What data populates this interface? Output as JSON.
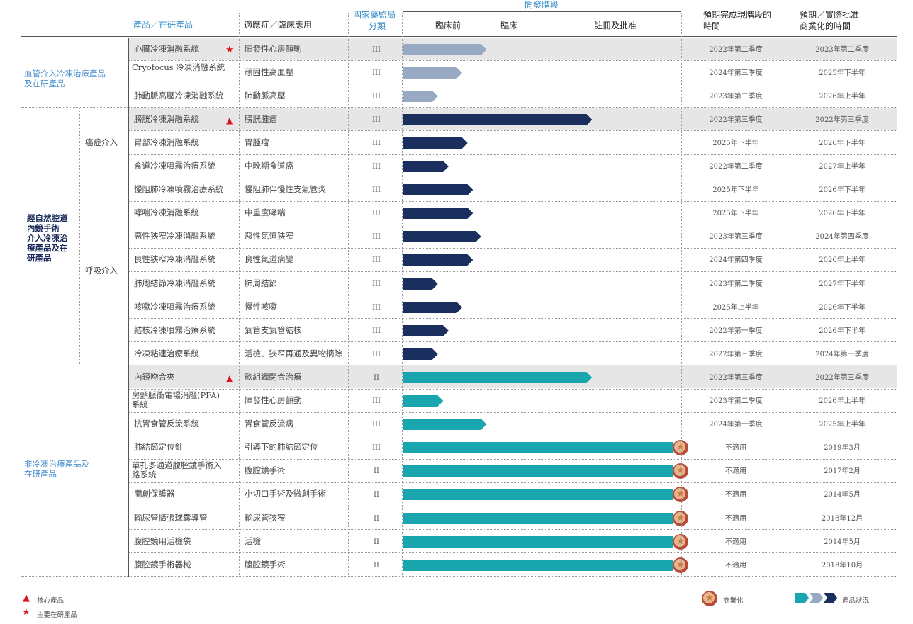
{
  "header": {
    "product": "產品／在研產品",
    "indication": "適應症／臨床應用",
    "nmpa": [
      "國家藥監局",
      "分類"
    ],
    "dev_stage": "開發階段",
    "stage_preclinical": "臨床前",
    "stage_clinical": "臨床",
    "stage_registration": "註冊及批准",
    "expected_completion": [
      "預期完成現階段的",
      "時間"
    ],
    "expected_commercial": [
      "預期／實際批准",
      "商業化的時間"
    ]
  },
  "groups": {
    "vascular": [
      "血管介入冷凍治療產品",
      "及在研產品"
    ],
    "natural": [
      "經自然腔道",
      "內鏡手術",
      "介入冷凍治",
      "療產品及在",
      "研產品"
    ],
    "cancer": "癌症介入",
    "respiratory": "呼吸介入",
    "noncryo": [
      "非冷凍治療產品及",
      "在研產品"
    ]
  },
  "rows": [
    {
      "product": "心臟冷凍消融系統",
      "indication": "陣發性心房顫動",
      "cls": "III",
      "progress": 0.31,
      "color": "gray",
      "done": "2022年第二季度",
      "commercial": "2023年第二季度",
      "highlight": true,
      "mark": "star"
    },
    {
      "product": "Cryofocus 冷凍消融系統",
      "indication": "頑固性高血壓",
      "cls": "III",
      "progress": 0.22,
      "color": "gray",
      "done": "2024年第三季度",
      "commercial": "2025年下半年",
      "highlight": false,
      "mark": ""
    },
    {
      "product": "肺動脈高壓冷凍消融系統",
      "indication": "肺動脈高壓",
      "cls": "III",
      "progress": 0.13,
      "color": "gray",
      "done": "2023年第二季度",
      "commercial": "2026年上半年",
      "highlight": false,
      "mark": ""
    },
    {
      "product": "膀胱冷凍消融系統",
      "indication": "膀胱腫瘤",
      "cls": "III",
      "progress": 0.7,
      "color": "navy",
      "done": "2022年第三季度",
      "commercial": "2022年第三季度",
      "highlight": true,
      "mark": "triangle"
    },
    {
      "product": "胃部冷凍消融系統",
      "indication": "胃腫瘤",
      "cls": "III",
      "progress": 0.24,
      "color": "navy",
      "done": "2025年下半年",
      "commercial": "2026年下半年",
      "highlight": false,
      "mark": ""
    },
    {
      "product": "食道冷凍噴霧治療系統",
      "indication": "中晚期食道癌",
      "cls": "III",
      "progress": 0.17,
      "color": "navy",
      "done": "2022年第二季度",
      "commercial": "2027年上半年",
      "highlight": false,
      "mark": ""
    },
    {
      "product": "慢阻肺冷凍噴霧治療系統",
      "indication": "慢阻肺伴慢性支氣管炎",
      "cls": "III",
      "progress": 0.26,
      "color": "navy",
      "done": "2025年下半年",
      "commercial": "2026年下半年",
      "highlight": false,
      "mark": ""
    },
    {
      "product": "哮喘冷凍消融系統",
      "indication": "中重度哮喘",
      "cls": "III",
      "progress": 0.26,
      "color": "navy",
      "done": "2025年下半年",
      "commercial": "2026年下半年",
      "highlight": false,
      "mark": ""
    },
    {
      "product": "惡性狹窄冷凍消融系統",
      "indication": "惡性氣道狹窄",
      "cls": "III",
      "progress": 0.29,
      "color": "navy",
      "done": "2023年第三季度",
      "commercial": "2024年第四季度",
      "highlight": false,
      "mark": ""
    },
    {
      "product": "良性狹窄冷凍消融系統",
      "indication": "良性氣道病變",
      "cls": "III",
      "progress": 0.26,
      "color": "navy",
      "done": "2024年第四季度",
      "commercial": "2026年上半年",
      "highlight": false,
      "mark": ""
    },
    {
      "product": "肺周結節冷凍消融系統",
      "indication": "肺周結節",
      "cls": "III",
      "progress": 0.13,
      "color": "navy",
      "done": "2023年第二季度",
      "commercial": "2027年下半年",
      "highlight": false,
      "mark": ""
    },
    {
      "product": "咳嗽冷凍噴霧治療系統",
      "indication": "慢性咳嗽",
      "cls": "III",
      "progress": 0.22,
      "color": "navy",
      "done": "2025年上半年",
      "commercial": "2026年下半年",
      "highlight": false,
      "mark": ""
    },
    {
      "product": "結核冷凍噴霧治療系統",
      "indication": "氣管支氣管結核",
      "cls": "III",
      "progress": 0.17,
      "color": "navy",
      "done": "2022年第一季度",
      "commercial": "2026年下半年",
      "highlight": false,
      "mark": ""
    },
    {
      "product": "冷凍粘連治療系統",
      "indication": "活檢、狹窄再通及異物摘除",
      "cls": "III",
      "progress": 0.13,
      "color": "navy",
      "done": "2022年第三季度",
      "commercial": "2024年第一季度",
      "highlight": false,
      "mark": ""
    },
    {
      "product": "內鏡吻合夾",
      "indication": "軟組織閉合治療",
      "cls": "II",
      "progress": 0.7,
      "color": "teal",
      "done": "2022年第三季度",
      "commercial": "2022年第三季度",
      "highlight": true,
      "mark": "triangle"
    },
    {
      "product": "房顫脈衝電場消融(PFA)系統",
      "indication": "陣發性心房顫動",
      "cls": "III",
      "progress": 0.15,
      "color": "teal",
      "done": "2023年第二季度",
      "commercial": "2026年上半年",
      "highlight": false,
      "mark": ""
    },
    {
      "product": "抗胃食管反流系統",
      "indication": "胃食管反流病",
      "cls": "III",
      "progress": 0.31,
      "color": "teal",
      "done": "2024年第一季度",
      "commercial": "2025年上半年",
      "highlight": false,
      "mark": ""
    },
    {
      "product": "肺結節定位針",
      "indication": "引導下的肺結節定位",
      "cls": "III",
      "progress": 1.0,
      "color": "teal",
      "done": "不適用",
      "commercial": "2019年3月",
      "highlight": false,
      "mark": "",
      "commercialized": true
    },
    {
      "product": "單孔多通道腹腔鏡手術入路系統",
      "indication": "腹腔鏡手術",
      "cls": "II",
      "progress": 1.0,
      "color": "teal",
      "done": "不適用",
      "commercial": "2017年2月",
      "highlight": false,
      "mark": "",
      "commercialized": true
    },
    {
      "product": "開創保護器",
      "indication": "小切口手術及微創手術",
      "cls": "II",
      "progress": 1.0,
      "color": "teal",
      "done": "不適用",
      "commercial": "2014年5月",
      "highlight": false,
      "mark": "",
      "commercialized": true
    },
    {
      "product": "輸尿管擴張球囊導管",
      "indication": "輸尿管狹窄",
      "cls": "II",
      "progress": 1.0,
      "color": "teal",
      "done": "不適用",
      "commercial": "2018年12月",
      "highlight": false,
      "mark": "",
      "commercialized": true
    },
    {
      "product": "腹腔鏡用活檢袋",
      "indication": "活檢",
      "cls": "II",
      "progress": 1.0,
      "color": "teal",
      "done": "不適用",
      "commercial": "2014年5月",
      "highlight": false,
      "mark": "",
      "commercialized": true
    },
    {
      "product": "腹腔鏡手術器械",
      "indication": "腹腔鏡手術",
      "cls": "II",
      "progress": 1.0,
      "color": "teal",
      "done": "不適用",
      "commercial": "2018年10月",
      "highlight": false,
      "mark": "",
      "commercialized": true
    }
  ],
  "colors": {
    "gray": "#98a9c4",
    "navy": "#1b2f5e",
    "teal": "#1aa6ae",
    "highlight": "#e6e6e6"
  },
  "legend": {
    "core": "核心產品",
    "major": "主要在研產品",
    "commercialized": "商業化",
    "status": "產品狀況"
  }
}
